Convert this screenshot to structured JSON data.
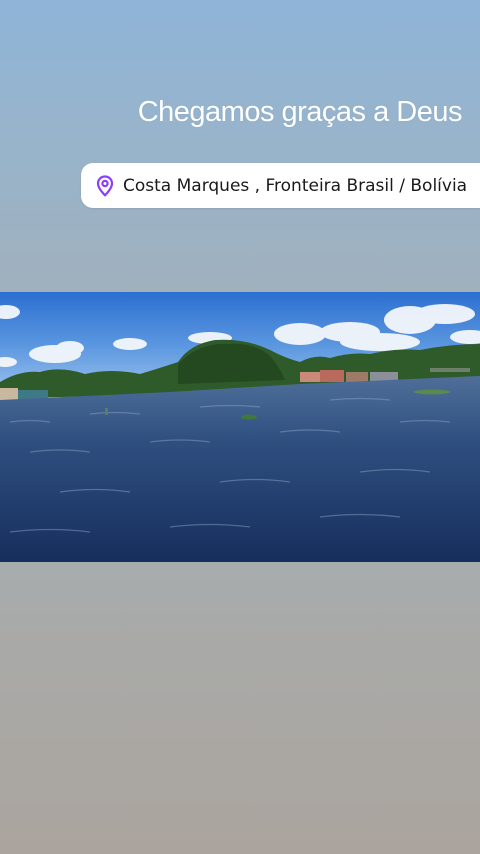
{
  "story": {
    "title": "Chegamos graças a Deus",
    "location": {
      "text": "Costa Marques , Fronteira Brasil / Bolívia",
      "icon": "location-pin-icon",
      "accent": "#8a3ffc"
    }
  },
  "photo": {
    "subject": "river-landscape-photo"
  }
}
